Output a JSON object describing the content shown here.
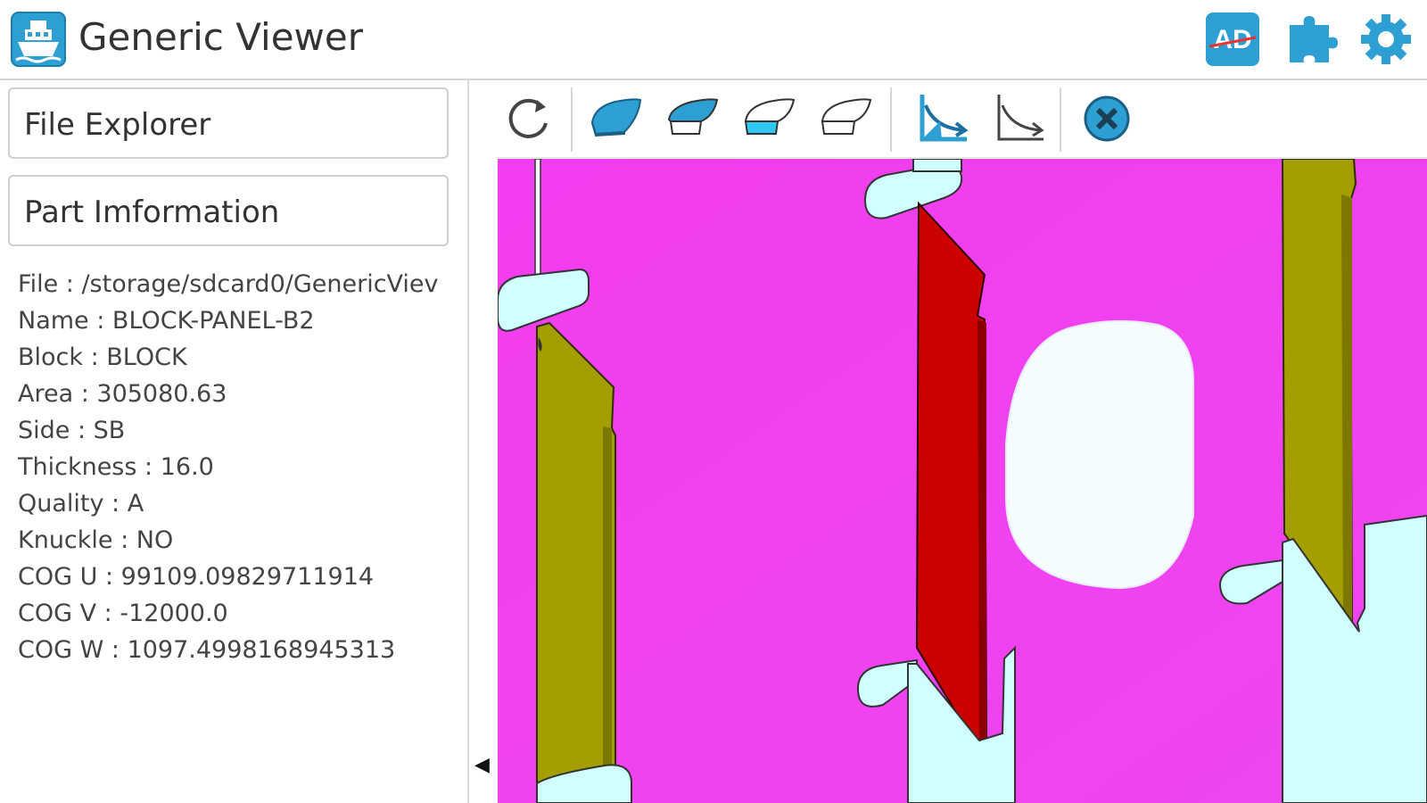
{
  "app": {
    "title": "Generic Viewer"
  },
  "header": {
    "ad_label": "AD"
  },
  "sidebar": {
    "file_explorer_label": "File Explorer",
    "part_information_label": "Part Imformation",
    "info_lines": [
      "File : /storage/sdcard0/GenericViev",
      "Name : BLOCK-PANEL-B2",
      "Block : BLOCK",
      "Area : 305080.63",
      "Side : SB",
      "Thickness : 16.0",
      "Quality : A",
      "Knuckle : NO",
      "COG U : 99109.09829711914",
      "COG V : -12000.0",
      "COG W : 1097.4998168945313"
    ]
  },
  "toolbar": {
    "icons": [
      "rotate-icon",
      "hull-solid-bottom-icon",
      "hull-solid-top-icon",
      "hull-wire-bottom-icon",
      "hull-wire-top-icon",
      "curve-graph-solid-icon",
      "curve-graph-outline-icon",
      "close-icon"
    ]
  },
  "colors": {
    "accent": "#2e9fd2",
    "viewport_bg": "#f040ee",
    "panel_olive": "#a39f00",
    "panel_red": "#cc0000",
    "bracket_cyan": "#cfffff"
  }
}
